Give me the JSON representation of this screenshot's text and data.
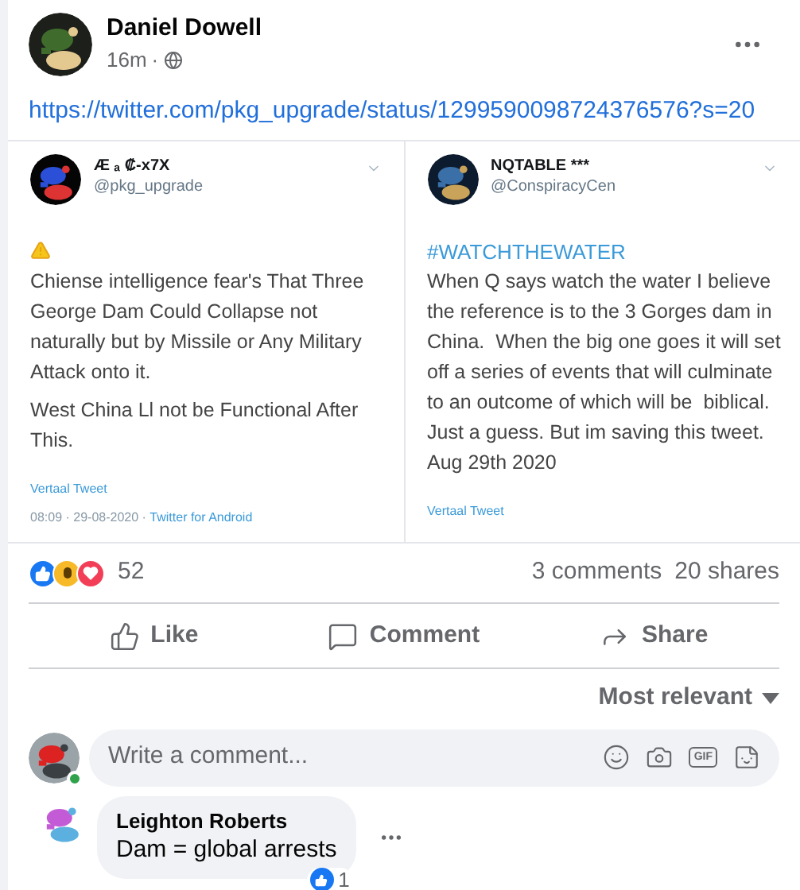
{
  "post": {
    "author": "Daniel Dowell",
    "time": "16m",
    "separator": "·",
    "link": "https://twitter.com/pkg_upgrade/status/1299590098724376576?s=20"
  },
  "tweets": [
    {
      "name": "Æ ₐ ₡-x7X",
      "handle": "@pkg_upgrade",
      "warning": true,
      "paragraphs": [
        "Chiense intelligence fear's That Three George Dam Could Collapse not naturally but by Missile or Any Military Attack onto it.",
        "West China Ll not be Functional After This."
      ],
      "translate": "Vertaal Tweet",
      "meta": "08:09 · 29-08-2020 · ",
      "source": "Twitter for Android"
    },
    {
      "name": "NQTABLE ***",
      "handle": "@ConspiracyCen",
      "hashtag": "#WATCHTHEWATER",
      "paragraphs": [
        "When Q says watch the water I believe the reference is to the 3 Gorges dam in China.  When the big one goes it will set off a series of events that will culminate to an outcome of which will be  biblical.\nJust a guess. But im saving this tweet.\nAug 29th 2020"
      ],
      "translate": "Vertaal Tweet"
    }
  ],
  "reactions": {
    "count": "52",
    "comments": "3 comments",
    "shares": "20 shares"
  },
  "actions": [
    {
      "kind": "like",
      "label": "Like"
    },
    {
      "kind": "comment",
      "label": "Comment"
    },
    {
      "kind": "share",
      "label": "Share"
    }
  ],
  "sort": {
    "label": "Most relevant"
  },
  "composer": {
    "placeholder": "Write a comment...",
    "online": true,
    "gif": "GIF"
  },
  "comments": [
    {
      "author": "Leighton Roberts",
      "text": "Dam = global arrests",
      "likes": "1"
    }
  ]
}
